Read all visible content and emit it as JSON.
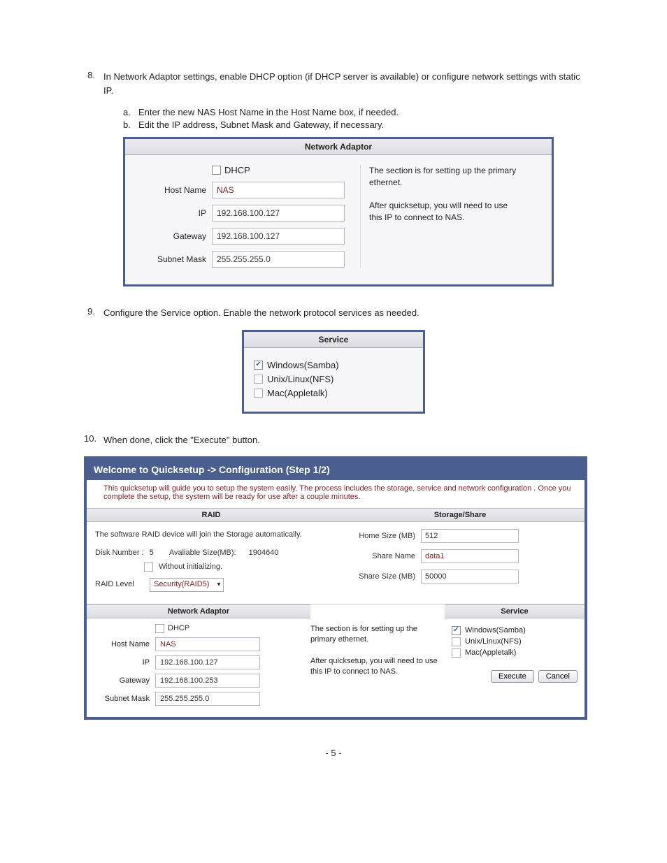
{
  "steps": {
    "s8": {
      "num": "8.",
      "text": "In Network Adaptor settings, enable DHCP option (if DHCP server is available) or configure network settings with static IP.",
      "subs": [
        {
          "num": "a.",
          "text": "Enter the new NAS Host Name in the Host Name box, if needed."
        },
        {
          "num": "b.",
          "text": "Edit the IP address, Subnet Mask and Gateway, if necessary."
        }
      ]
    },
    "s9": {
      "num": "9.",
      "text": "Configure the Service option. Enable the network protocol services as needed."
    },
    "s10": {
      "num": "10.",
      "text": "When done, click the \"Execute\" button."
    }
  },
  "network_adaptor_large": {
    "title": "Network Adaptor",
    "dhcp_label": "DHCP",
    "labels": {
      "host": "Host Name",
      "ip": "IP",
      "gateway": "Gateway",
      "subnet": "Subnet Mask"
    },
    "values": {
      "host": "NAS",
      "ip": "192.168.100.127",
      "gateway": "192.168.100.127",
      "subnet": "255.255.255.0"
    },
    "info1": "The section is for setting up the primary ethernet.",
    "info2": "After quicksetup, you will need to use this IP to connect to NAS."
  },
  "service_small": {
    "title": "Service",
    "options": [
      {
        "label": "Windows(Samba)",
        "checked": true
      },
      {
        "label": "Unix/Linux(NFS)",
        "checked": false
      },
      {
        "label": "Mac(Appletalk)",
        "checked": false
      }
    ]
  },
  "quicksetup": {
    "title": "Welcome to Quicksetup -> Configuration (Step 1/2)",
    "desc": "This quicksetup will guide you to setup the system easily. The process includes the storage, service and network configuration . Once you complete the setup, the system will be ready for use after a couple minutes.",
    "raid": {
      "head": "RAID",
      "line1": "The software RAID device will join the Storage automatically.",
      "disk_num_label": "Disk Number :",
      "disk_num": "5",
      "avail_label": "Avaliable Size(MB):",
      "avail": "1904640",
      "without_init": "Without initializing.",
      "raid_level_label": "RAID Level",
      "raid_level_value": "Security(RAID5)"
    },
    "storage": {
      "head": "Storage/Share",
      "labels": {
        "home": "Home Size (MB)",
        "share_name": "Share Name",
        "share_size": "Share Size (MB)"
      },
      "values": {
        "home": "512",
        "share_name": "data1",
        "share_size": "50000"
      }
    },
    "na": {
      "head": "Network Adaptor",
      "dhcp_label": "DHCP",
      "labels": {
        "host": "Host Name",
        "ip": "IP",
        "gateway": "Gateway",
        "subnet": "Subnet Mask"
      },
      "values": {
        "host": "NAS",
        "ip": "192.168.100.127",
        "gateway": "192.168.100.253",
        "subnet": "255.255.255.0"
      },
      "info1": "The section is for setting up the primary ethernet.",
      "info2": "After quicksetup, you will need to use this IP to connect to NAS."
    },
    "service": {
      "head": "Service",
      "options": [
        {
          "label": "Windows(Samba)",
          "checked": true
        },
        {
          "label": "Unix/Linux(NFS)",
          "checked": false
        },
        {
          "label": "Mac(Appletalk)",
          "checked": false
        }
      ]
    },
    "buttons": {
      "execute": "Execute",
      "cancel": "Cancel"
    }
  },
  "page_number": "- 5 -"
}
